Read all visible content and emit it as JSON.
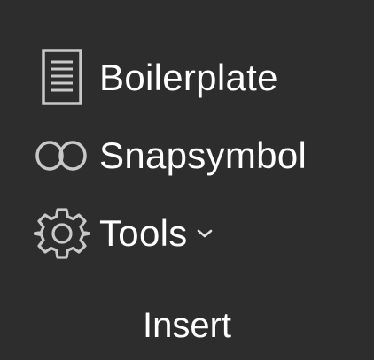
{
  "group": {
    "label": "Insert"
  },
  "commands": [
    {
      "label": "Boilerplate",
      "icon": "document-icon"
    },
    {
      "label": "Snapsymbol",
      "icon": "snapsymbol-icon"
    },
    {
      "label": "Tools",
      "icon": "gear-icon",
      "has_dropdown": true
    }
  ],
  "colors": {
    "background": "#2d2d2d",
    "text": "#ffffff",
    "icon_stroke": "#c8c8c8"
  }
}
